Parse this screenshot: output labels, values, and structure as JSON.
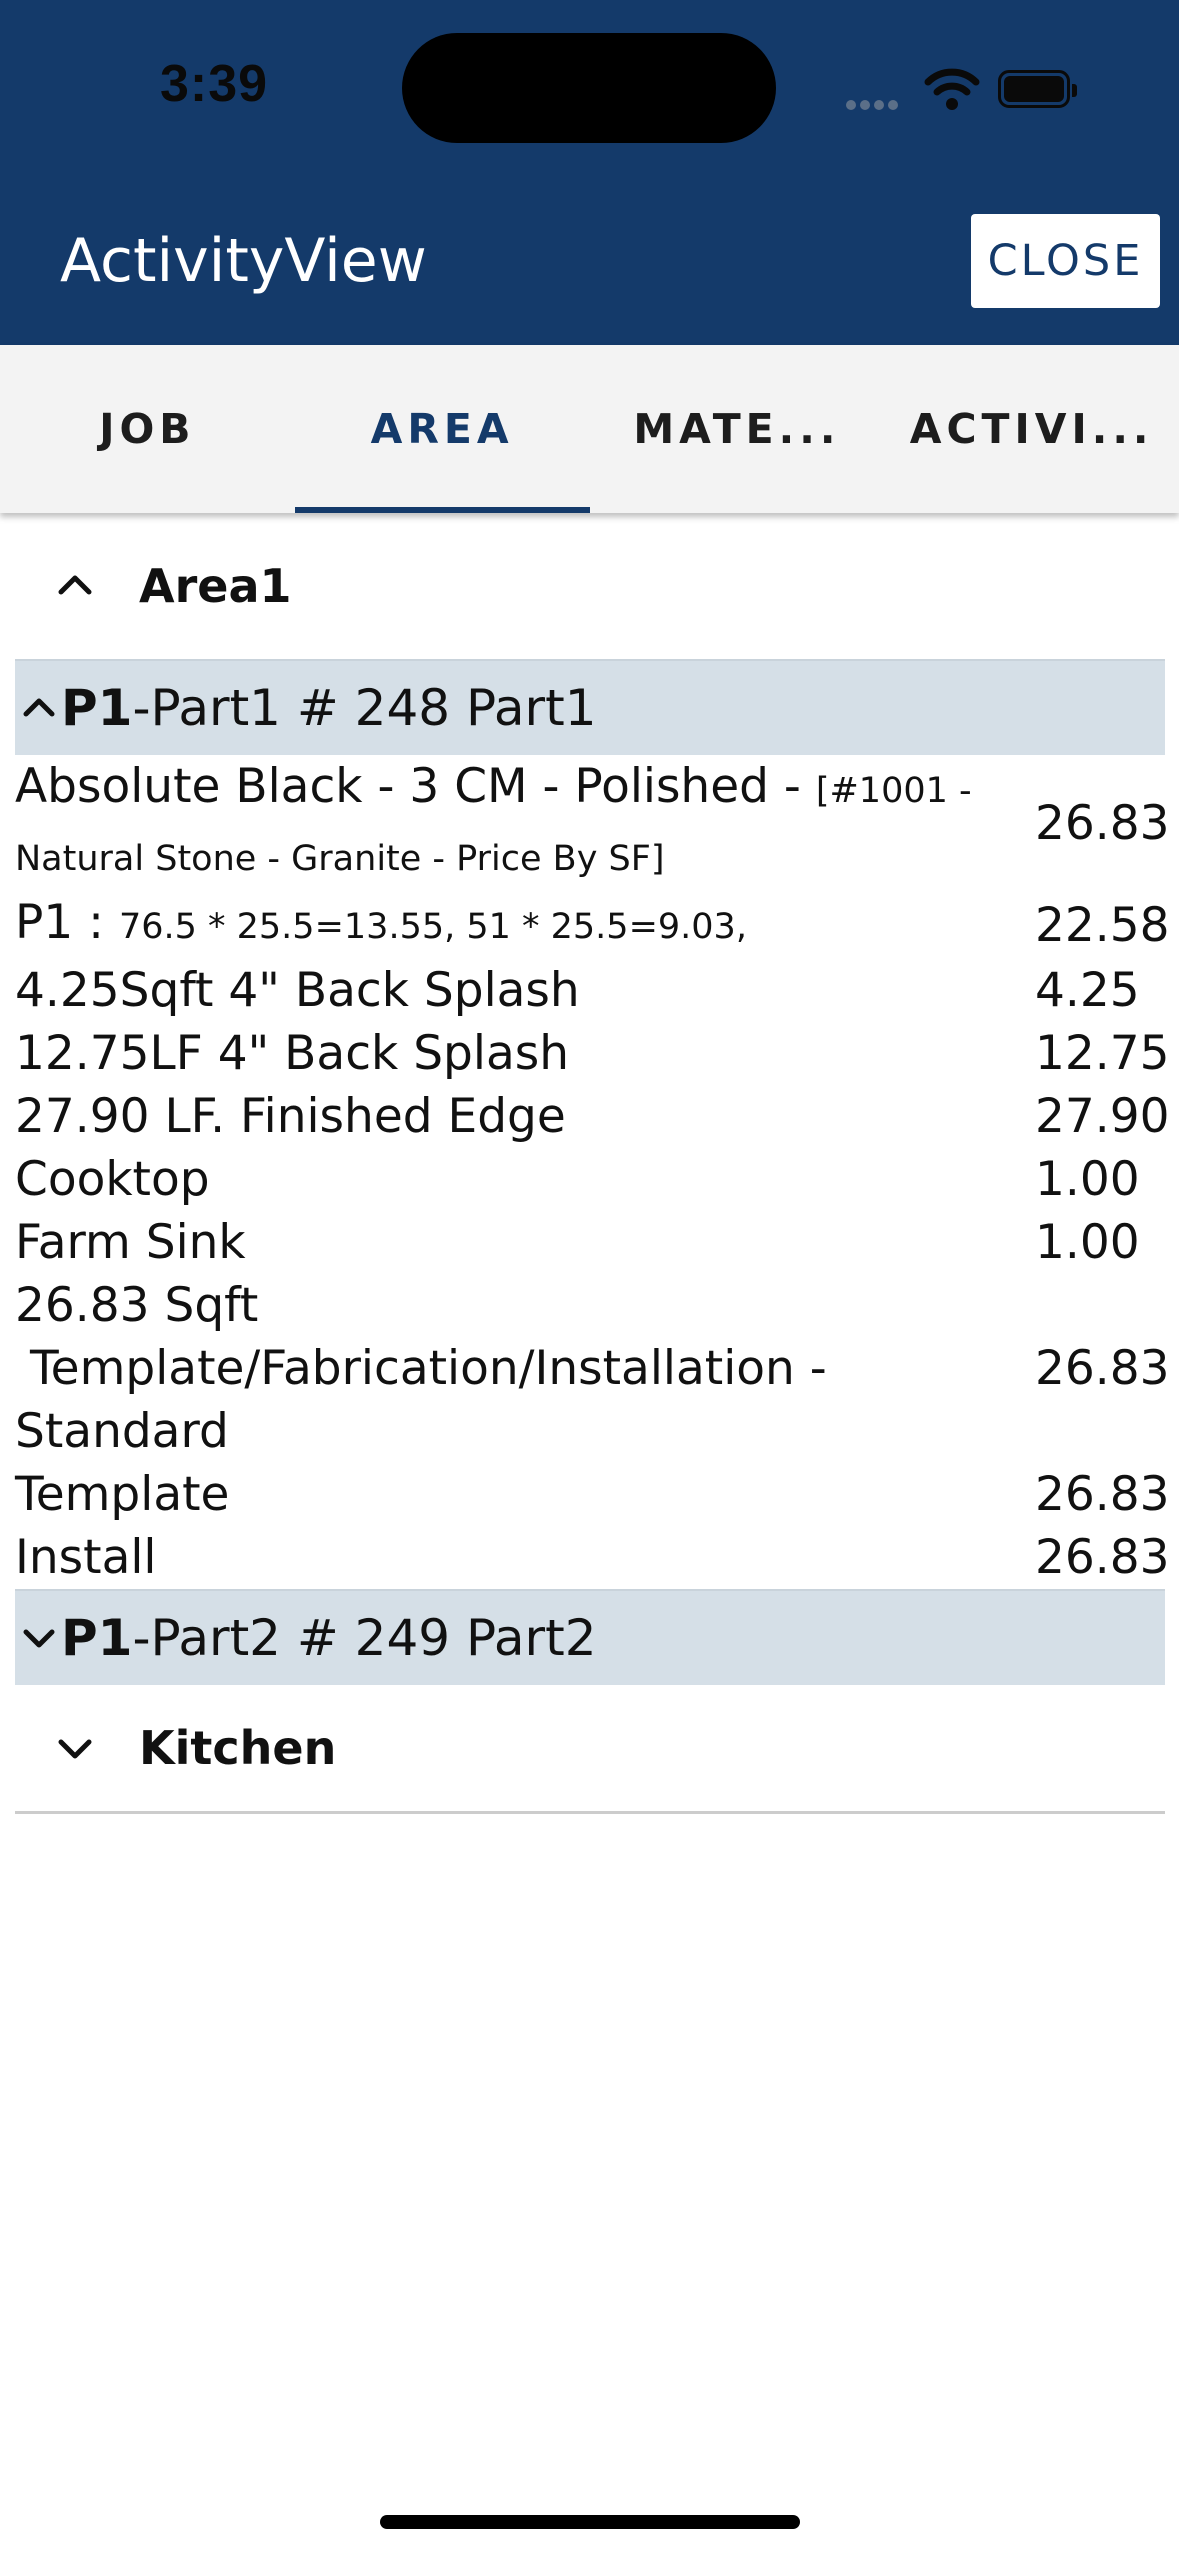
{
  "status_bar": {
    "time": "3:39"
  },
  "app": {
    "title": "ActivityView",
    "close_label": "CLOSE"
  },
  "tabs": [
    {
      "label": "JOB"
    },
    {
      "label": "AREA"
    },
    {
      "label": "MATE..."
    },
    {
      "label": "ACTIVI..."
    }
  ],
  "areas": [
    {
      "name": "Area1",
      "parts": [
        {
          "code": "P1",
          "title": "-Part1 # 248 Part1",
          "items": [
            {
              "desc_main": "Absolute Black - 3 CM - Polished - ",
              "desc_small": "[#1001 - Natural Stone - Granite - Price By SF]",
              "value": "26.83"
            },
            {
              "desc_main": "P1 : ",
              "desc_small": "76.5 * 25.5=13.55,  51 * 25.5=9.03,",
              "value": "22.58"
            },
            {
              "desc_main": "4.25Sqft 4\" Back Splash",
              "value": "4.25"
            },
            {
              "desc_main": "12.75LF 4\" Back Splash",
              "value": "12.75"
            },
            {
              "desc_main": "27.90 LF. Finished Edge",
              "value": "27.90"
            },
            {
              "desc_main": "Cooktop",
              "value": "1.00"
            },
            {
              "desc_main": "Farm Sink",
              "value": "1.00"
            },
            {
              "desc_main": "26.83 Sqft",
              "value": ""
            },
            {
              "desc_main": " Template/Fabrication/Installation - Standard",
              "value": "26.83"
            },
            {
              "desc_main": "Template",
              "value": "26.83"
            },
            {
              "desc_main": "Install",
              "value": "26.83"
            }
          ]
        },
        {
          "code": "P1",
          "title": "-Part2 # 249 Part2"
        }
      ]
    },
    {
      "name": "Kitchen"
    }
  ]
}
